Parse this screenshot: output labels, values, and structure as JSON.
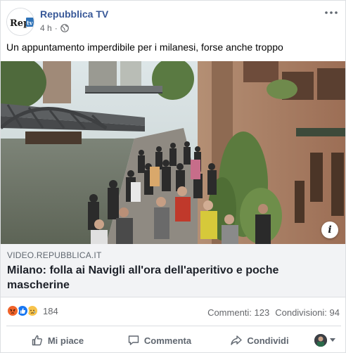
{
  "post": {
    "page_name": "Repubblica TV",
    "time": "4 h",
    "separator": "·",
    "privacy_icon": "globe-icon",
    "text": "Un appuntamento imperdibile per i milanesi, forse anche troppo"
  },
  "logo": {
    "text_rep": "Rep",
    "text_tv": "tv"
  },
  "link": {
    "domain": "VIDEO.REPUBBLICA.IT",
    "title": "Milano: folla ai Navigli all'ora dell'aperitivo e poche mascherine",
    "info_label": "i"
  },
  "stats": {
    "reaction_icons": [
      "angry-icon",
      "like-icon",
      "sad-icon"
    ],
    "reaction_count": "184",
    "comments": "Commenti: 123",
    "shares": "Condivisioni: 94"
  },
  "actions": {
    "like": "Mi piace",
    "comment": "Commenta",
    "share": "Condividi"
  },
  "colors": {
    "page_name": "#385898",
    "angry": "#f0632a",
    "like": "#1877f2",
    "sad": "#f7c34b",
    "secondary_text": "#65676b"
  }
}
